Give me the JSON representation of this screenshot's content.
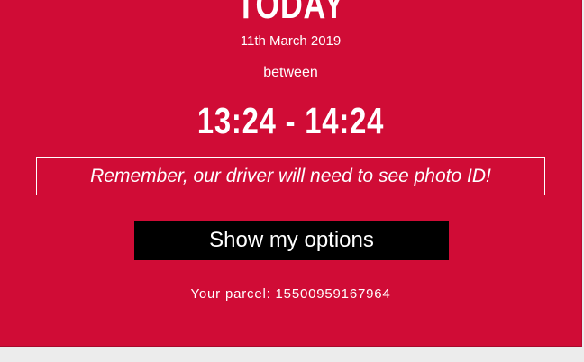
{
  "delivery": {
    "day": "TODAY",
    "date": "11th March 2019",
    "between_label": "between",
    "time_window": "13:24 - 14:24",
    "notice": "Remember, our driver will need to see photo ID!",
    "options_button": "Show my options",
    "parcel_label": "Your parcel: 15500959167964"
  },
  "colors": {
    "card_background": "#d00c36",
    "button_background": "#000000",
    "page_background": "#ececec",
    "text": "#ffffff"
  }
}
